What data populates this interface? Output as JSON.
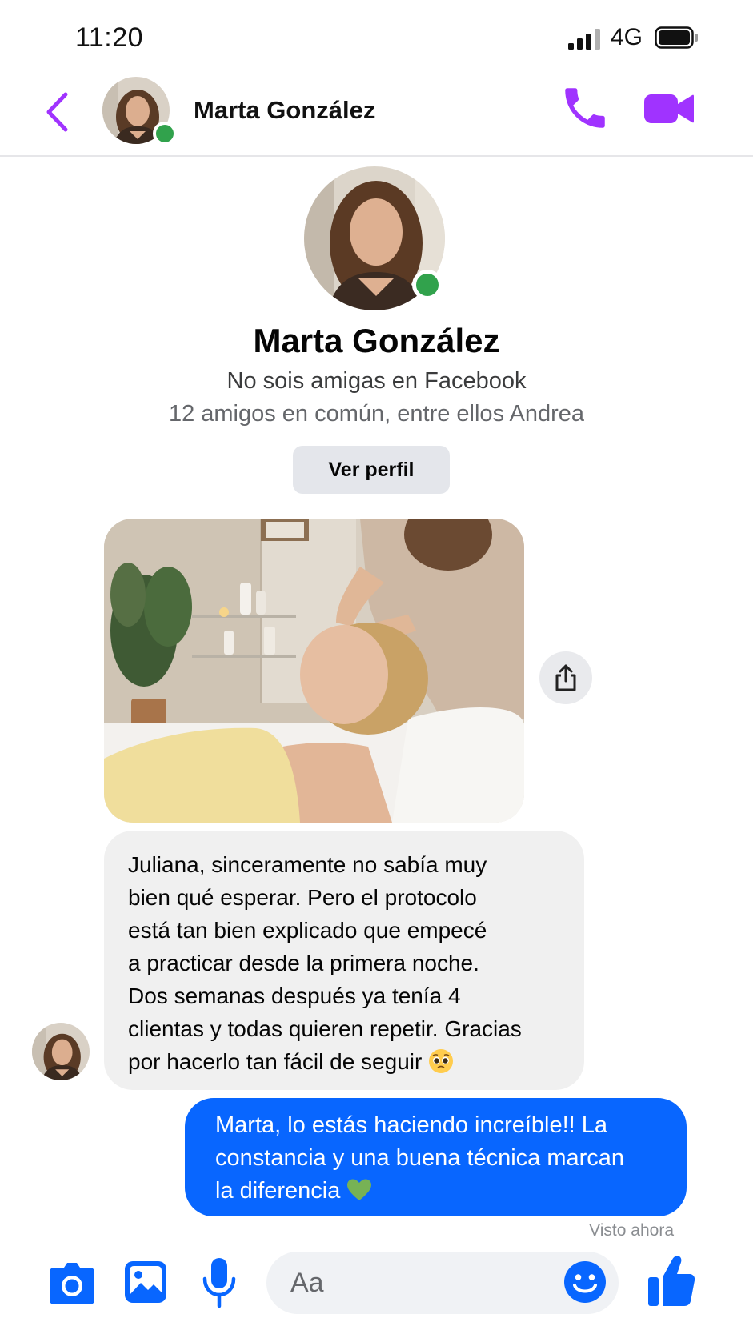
{
  "status_bar": {
    "time": "11:20",
    "network": "4G"
  },
  "header": {
    "contact_name": "Marta González"
  },
  "profile": {
    "name": "Marta González",
    "relationship": "No sois amigas en Facebook",
    "mutual_friends": "12 amigos en común, entre ellos Andrea",
    "view_profile_label": "Ver perfil"
  },
  "messages": [
    {
      "direction": "incoming",
      "type": "photo"
    },
    {
      "direction": "incoming",
      "type": "text",
      "lines": [
        "Juliana, sinceramente no sabía muy",
        "bien qué esperar. Pero el protocolo",
        "está tan bien explicado que empecé",
        "a practicar desde la primera noche.",
        "Dos semanas después ya tenía 4",
        "clientas y todas quieren repetir. Gracias",
        "por hacerlo tan fácil de seguir"
      ],
      "emoji": "pleading-face"
    },
    {
      "direction": "outgoing",
      "type": "text",
      "lines": [
        "Marta, lo estás haciendo increíble!! La",
        "constancia y una buena técnica marcan",
        "la diferencia"
      ],
      "emoji": "green-heart"
    }
  ],
  "seen_status": "Visto ahora",
  "composer": {
    "placeholder": "Aa"
  },
  "colors": {
    "accent_purple": "#a033ff",
    "messenger_blue": "#0866ff",
    "online_green": "#31a24c"
  },
  "icons": [
    "back-chevron-icon",
    "phone-icon",
    "video-camera-icon",
    "share-icon",
    "camera-icon",
    "gallery-icon",
    "microphone-icon",
    "smiley-icon",
    "thumbs-up-icon"
  ]
}
